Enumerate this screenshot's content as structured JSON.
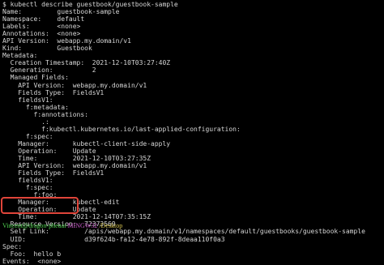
{
  "terminal": {
    "lines": [
      "$ kubectl describe guestbook/guestbook-sample",
      "Name:         guestbook-sample",
      "Namespace:    default",
      "Labels:       <none>",
      "Annotations:  <none>",
      "API Version:  webapp.my.domain/v1",
      "Kind:         Guestbook",
      "Metadata:",
      "  Creation Timestamp:  2021-12-10T03:27:40Z",
      "  Generation:          2",
      "  Managed Fields:",
      "    API Version:  webapp.my.domain/v1",
      "    Fields Type:  FieldsV1",
      "    fieldsV1:",
      "      f:metadata:",
      "        f:annotations:",
      "          .:",
      "          f:kubectl.kubernetes.io/last-applied-configuration:",
      "      f:spec:",
      "    Manager:      kubectl-client-side-apply",
      "    Operation:    Update",
      "    Time:         2021-12-10T03:27:35Z",
      "    API Version:  webapp.my.domain/v1",
      "    Fields Type:  FieldsV1",
      "    fieldsV1:",
      "      f:spec:",
      "        f:foo:",
      "    Manager:      kubectl-edit",
      "    Operation:    Update",
      "    Time:         2021-12-14T07:35:15Z",
      "  Resource Version:  72373569",
      "  Self Link:         /apis/webapp.my.domain/v1/namespaces/default/guestbooks/guestbook-sample",
      "  UID:               d39f624b-fa12-4e78-892f-8deaa110f0a3",
      "Spec:",
      "  Foo:  hello b",
      "Events:  <none>"
    ],
    "prompt": {
      "user": "Vincent@dragon-pheuai",
      "separator": " ",
      "host": "MINGW32",
      "path": " /Desktop"
    },
    "highlight_color": "#e0453a"
  }
}
